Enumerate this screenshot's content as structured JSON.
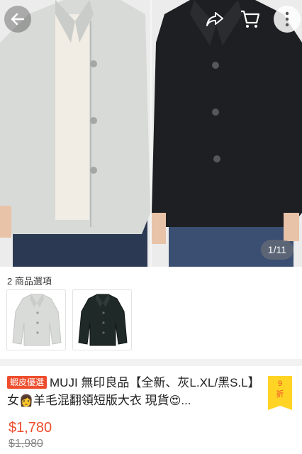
{
  "hero": {
    "image_counter": "1/11",
    "colors": {
      "light_coat": "#d7dad6",
      "dark_coat": "#1e1f22",
      "jeans": "#2b3a52",
      "skin": "#e8c3a8",
      "bg": "#ececec"
    }
  },
  "toolbar": {
    "back_icon": "back-arrow-icon",
    "share_icon": "share-icon",
    "cart_icon": "cart-icon",
    "more_icon": "more-vertical-icon"
  },
  "options": {
    "label": "2 商品選項",
    "items": [
      {
        "name": "light-gray-coat"
      },
      {
        "name": "black-coat"
      }
    ]
  },
  "product": {
    "badge": "蝦皮優選",
    "title_part1": "MUJI 無印良品【全新、灰L.XL/黑S.L】女",
    "emoji1": "👩",
    "title_part2": "羊毛混翻領短版大衣 現貨",
    "emoji2": "😍",
    "ellipsis": "...",
    "discount_number": "9",
    "discount_unit": "折",
    "price": "$1,780",
    "original_price": "$1,980",
    "accent_color": "#ee4d2d"
  }
}
